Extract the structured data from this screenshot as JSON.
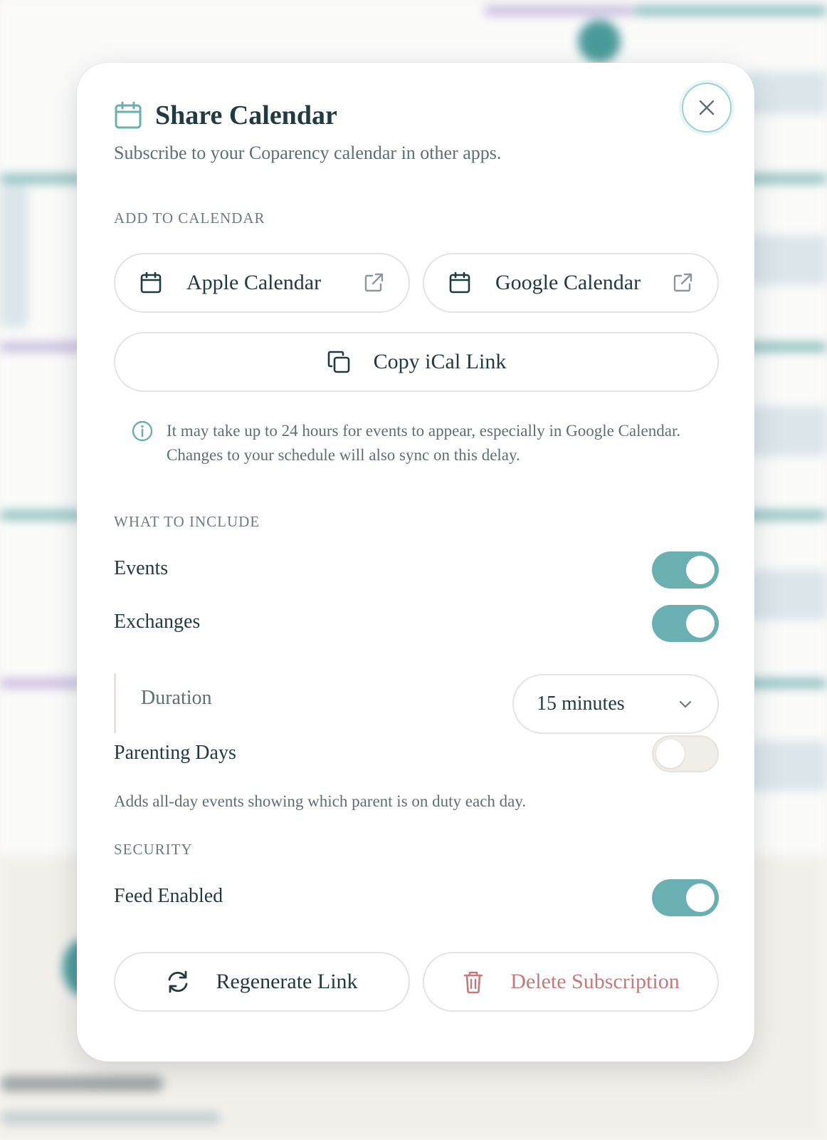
{
  "dialog": {
    "title": "Share Calendar",
    "subtitle": "Subscribe to your Coparency calendar in other apps."
  },
  "add_section": {
    "label": "ADD TO CALENDAR",
    "apple_label": "Apple Calendar",
    "google_label": "Google Calendar",
    "copy_label": "Copy iCal Link",
    "info_text": "It may take up to 24 hours for events to appear, especially in Google Calendar. Changes to your schedule will also sync on this delay."
  },
  "include_section": {
    "label": "WHAT TO INCLUDE",
    "events": {
      "label": "Events",
      "on": true
    },
    "exchanges": {
      "label": "Exchanges",
      "on": true
    },
    "duration": {
      "label": "Duration",
      "selected": "15 minutes"
    },
    "parenting_days": {
      "label": "Parenting Days",
      "on": false,
      "hint": "Adds all-day events showing which parent is on duty each day."
    }
  },
  "security_section": {
    "label": "SECURITY",
    "feed_enabled": {
      "label": "Feed Enabled",
      "on": true
    },
    "regenerate_label": "Regenerate Link",
    "delete_label": "Delete Subscription"
  },
  "colors": {
    "accent": "#6ab0b3",
    "text": "#1f3a40",
    "muted": "#5e6f74",
    "danger": "#c4797b"
  },
  "icons": {
    "title": "calendar-icon",
    "close": "close-icon",
    "external": "external-link-icon",
    "copy": "copy-icon",
    "info": "info-icon",
    "chevron": "chevron-down-icon",
    "regenerate": "refresh-icon",
    "delete": "trash-icon"
  }
}
